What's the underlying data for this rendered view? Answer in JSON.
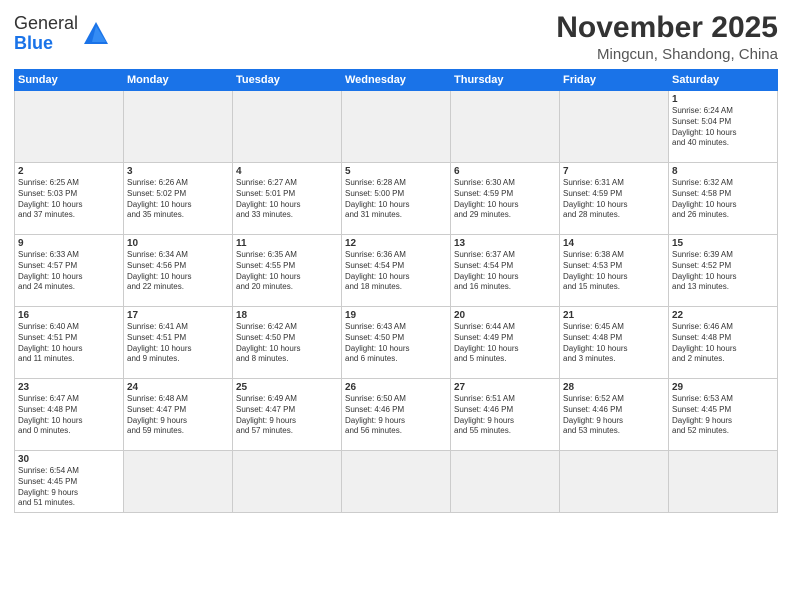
{
  "logo": {
    "text_general": "General",
    "text_blue": "Blue"
  },
  "title": "November 2025",
  "subtitle": "Mingcun, Shandong, China",
  "days_of_week": [
    "Sunday",
    "Monday",
    "Tuesday",
    "Wednesday",
    "Thursday",
    "Friday",
    "Saturday"
  ],
  "weeks": [
    [
      {
        "num": "",
        "info": "",
        "empty": true
      },
      {
        "num": "",
        "info": "",
        "empty": true
      },
      {
        "num": "",
        "info": "",
        "empty": true
      },
      {
        "num": "",
        "info": "",
        "empty": true
      },
      {
        "num": "",
        "info": "",
        "empty": true
      },
      {
        "num": "",
        "info": "",
        "empty": true
      },
      {
        "num": "1",
        "info": "Sunrise: 6:24 AM\nSunset: 5:04 PM\nDaylight: 10 hours\nand 40 minutes."
      }
    ],
    [
      {
        "num": "2",
        "info": "Sunrise: 6:25 AM\nSunset: 5:03 PM\nDaylight: 10 hours\nand 37 minutes."
      },
      {
        "num": "3",
        "info": "Sunrise: 6:26 AM\nSunset: 5:02 PM\nDaylight: 10 hours\nand 35 minutes."
      },
      {
        "num": "4",
        "info": "Sunrise: 6:27 AM\nSunset: 5:01 PM\nDaylight: 10 hours\nand 33 minutes."
      },
      {
        "num": "5",
        "info": "Sunrise: 6:28 AM\nSunset: 5:00 PM\nDaylight: 10 hours\nand 31 minutes."
      },
      {
        "num": "6",
        "info": "Sunrise: 6:30 AM\nSunset: 4:59 PM\nDaylight: 10 hours\nand 29 minutes."
      },
      {
        "num": "7",
        "info": "Sunrise: 6:31 AM\nSunset: 4:59 PM\nDaylight: 10 hours\nand 28 minutes."
      },
      {
        "num": "8",
        "info": "Sunrise: 6:32 AM\nSunset: 4:58 PM\nDaylight: 10 hours\nand 26 minutes."
      }
    ],
    [
      {
        "num": "9",
        "info": "Sunrise: 6:33 AM\nSunset: 4:57 PM\nDaylight: 10 hours\nand 24 minutes."
      },
      {
        "num": "10",
        "info": "Sunrise: 6:34 AM\nSunset: 4:56 PM\nDaylight: 10 hours\nand 22 minutes."
      },
      {
        "num": "11",
        "info": "Sunrise: 6:35 AM\nSunset: 4:55 PM\nDaylight: 10 hours\nand 20 minutes."
      },
      {
        "num": "12",
        "info": "Sunrise: 6:36 AM\nSunset: 4:54 PM\nDaylight: 10 hours\nand 18 minutes."
      },
      {
        "num": "13",
        "info": "Sunrise: 6:37 AM\nSunset: 4:54 PM\nDaylight: 10 hours\nand 16 minutes."
      },
      {
        "num": "14",
        "info": "Sunrise: 6:38 AM\nSunset: 4:53 PM\nDaylight: 10 hours\nand 15 minutes."
      },
      {
        "num": "15",
        "info": "Sunrise: 6:39 AM\nSunset: 4:52 PM\nDaylight: 10 hours\nand 13 minutes."
      }
    ],
    [
      {
        "num": "16",
        "info": "Sunrise: 6:40 AM\nSunset: 4:51 PM\nDaylight: 10 hours\nand 11 minutes."
      },
      {
        "num": "17",
        "info": "Sunrise: 6:41 AM\nSunset: 4:51 PM\nDaylight: 10 hours\nand 9 minutes."
      },
      {
        "num": "18",
        "info": "Sunrise: 6:42 AM\nSunset: 4:50 PM\nDaylight: 10 hours\nand 8 minutes."
      },
      {
        "num": "19",
        "info": "Sunrise: 6:43 AM\nSunset: 4:50 PM\nDaylight: 10 hours\nand 6 minutes."
      },
      {
        "num": "20",
        "info": "Sunrise: 6:44 AM\nSunset: 4:49 PM\nDaylight: 10 hours\nand 5 minutes."
      },
      {
        "num": "21",
        "info": "Sunrise: 6:45 AM\nSunset: 4:48 PM\nDaylight: 10 hours\nand 3 minutes."
      },
      {
        "num": "22",
        "info": "Sunrise: 6:46 AM\nSunset: 4:48 PM\nDaylight: 10 hours\nand 2 minutes."
      }
    ],
    [
      {
        "num": "23",
        "info": "Sunrise: 6:47 AM\nSunset: 4:48 PM\nDaylight: 10 hours\nand 0 minutes."
      },
      {
        "num": "24",
        "info": "Sunrise: 6:48 AM\nSunset: 4:47 PM\nDaylight: 9 hours\nand 59 minutes."
      },
      {
        "num": "25",
        "info": "Sunrise: 6:49 AM\nSunset: 4:47 PM\nDaylight: 9 hours\nand 57 minutes."
      },
      {
        "num": "26",
        "info": "Sunrise: 6:50 AM\nSunset: 4:46 PM\nDaylight: 9 hours\nand 56 minutes."
      },
      {
        "num": "27",
        "info": "Sunrise: 6:51 AM\nSunset: 4:46 PM\nDaylight: 9 hours\nand 55 minutes."
      },
      {
        "num": "28",
        "info": "Sunrise: 6:52 AM\nSunset: 4:46 PM\nDaylight: 9 hours\nand 53 minutes."
      },
      {
        "num": "29",
        "info": "Sunrise: 6:53 AM\nSunset: 4:45 PM\nDaylight: 9 hours\nand 52 minutes."
      }
    ],
    [
      {
        "num": "30",
        "info": "Sunrise: 6:54 AM\nSunset: 4:45 PM\nDaylight: 9 hours\nand 51 minutes.",
        "last": true
      },
      {
        "num": "",
        "info": "",
        "empty": true,
        "last": true
      },
      {
        "num": "",
        "info": "",
        "empty": true,
        "last": true
      },
      {
        "num": "",
        "info": "",
        "empty": true,
        "last": true
      },
      {
        "num": "",
        "info": "",
        "empty": true,
        "last": true
      },
      {
        "num": "",
        "info": "",
        "empty": true,
        "last": true
      },
      {
        "num": "",
        "info": "",
        "empty": true,
        "last": true
      }
    ]
  ]
}
